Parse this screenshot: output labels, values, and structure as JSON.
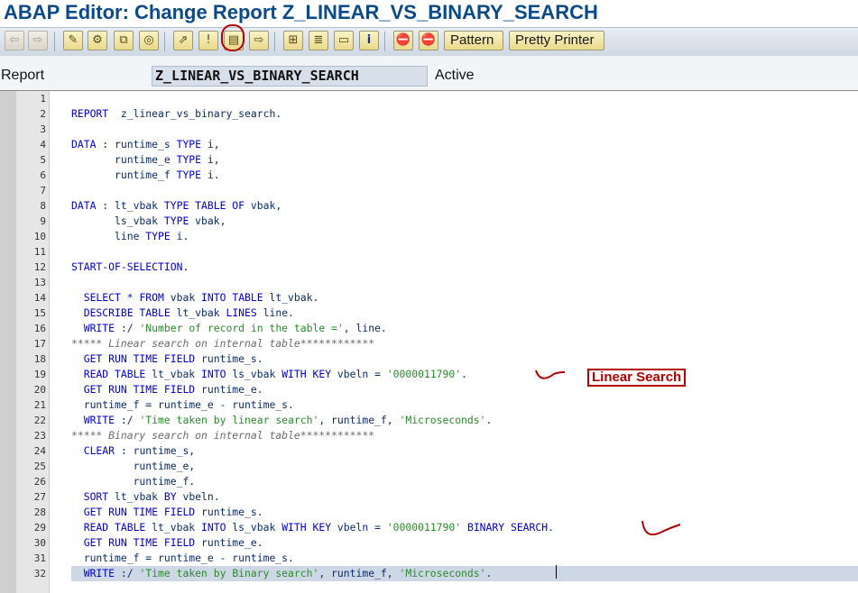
{
  "window": {
    "title": "ABAP Editor: Change Report Z_LINEAR_VS_BINARY_SEARCH"
  },
  "toolbar": {
    "buttons": [
      {
        "icon": "back-arrow-icon",
        "glyph": "⇦"
      },
      {
        "icon": "forward-arrow-icon",
        "glyph": "⇨"
      },
      {
        "icon": "display-change-icon",
        "glyph": "✎"
      },
      {
        "icon": "active-inactive-icon",
        "glyph": "⚙"
      },
      {
        "icon": "other-object-icon",
        "glyph": "⧉"
      },
      {
        "icon": "check-icon",
        "glyph": "◎"
      },
      {
        "icon": "activate-icon",
        "glyph": "⇗"
      },
      {
        "icon": "test-icon",
        "glyph": "!"
      },
      {
        "icon": "where-used-icon",
        "glyph": "▤"
      },
      {
        "icon": "navigate-icon",
        "glyph": "⇨"
      },
      {
        "icon": "object-list-icon",
        "glyph": "⊞"
      },
      {
        "icon": "display-object-list-icon",
        "glyph": "≣"
      },
      {
        "icon": "fullscreen-icon",
        "glyph": "▭"
      },
      {
        "icon": "info-icon",
        "glyph": "i"
      },
      {
        "icon": "breakpoint-icon",
        "glyph": "⛔"
      },
      {
        "icon": "session-breakpoint-icon",
        "glyph": "⛔"
      }
    ],
    "pattern_label": "Pattern",
    "pretty_printer_label": "Pretty Printer"
  },
  "report_bar": {
    "label": "Report",
    "name": "Z_LINEAR_VS_BINARY_SEARCH",
    "status": "Active"
  },
  "code_lines": [
    {
      "n": "1",
      "tokens": []
    },
    {
      "n": "2",
      "tokens": [
        {
          "t": "kw",
          "v": "REPORT"
        },
        {
          "t": "id",
          "v": "  z_linear_vs_binary_search."
        }
      ]
    },
    {
      "n": "3",
      "tokens": []
    },
    {
      "n": "4",
      "tokens": [
        {
          "t": "kw",
          "v": "DATA"
        },
        {
          "t": "id",
          "v": " : runtime_s "
        },
        {
          "t": "kw",
          "v": "TYPE"
        },
        {
          "t": "id",
          "v": " i,"
        }
      ]
    },
    {
      "n": "5",
      "tokens": [
        {
          "t": "id",
          "v": "       runtime_e "
        },
        {
          "t": "kw",
          "v": "TYPE"
        },
        {
          "t": "id",
          "v": " i,"
        }
      ]
    },
    {
      "n": "6",
      "tokens": [
        {
          "t": "id",
          "v": "       runtime_f "
        },
        {
          "t": "kw",
          "v": "TYPE"
        },
        {
          "t": "id",
          "v": " i."
        }
      ]
    },
    {
      "n": "7",
      "tokens": []
    },
    {
      "n": "8",
      "tokens": [
        {
          "t": "kw",
          "v": "DATA"
        },
        {
          "t": "id",
          "v": " : lt_vbak "
        },
        {
          "t": "kw",
          "v": "TYPE TABLE OF"
        },
        {
          "t": "id",
          "v": " vbak,"
        }
      ]
    },
    {
      "n": "9",
      "tokens": [
        {
          "t": "id",
          "v": "       ls_vbak "
        },
        {
          "t": "kw",
          "v": "TYPE"
        },
        {
          "t": "id",
          "v": " vbak,"
        }
      ]
    },
    {
      "n": "10",
      "tokens": [
        {
          "t": "id",
          "v": "       line "
        },
        {
          "t": "kw",
          "v": "TYPE"
        },
        {
          "t": "id",
          "v": " i."
        }
      ]
    },
    {
      "n": "11",
      "tokens": []
    },
    {
      "n": "12",
      "tokens": [
        {
          "t": "kw",
          "v": "START-OF-SELECTION."
        }
      ]
    },
    {
      "n": "13",
      "tokens": []
    },
    {
      "n": "14",
      "tokens": [
        {
          "t": "kw",
          "v": "  SELECT"
        },
        {
          "t": "id",
          "v": " * "
        },
        {
          "t": "kw",
          "v": "FROM"
        },
        {
          "t": "id",
          "v": " vbak "
        },
        {
          "t": "kw",
          "v": "INTO TABLE"
        },
        {
          "t": "id",
          "v": " lt_vbak."
        }
      ]
    },
    {
      "n": "15",
      "tokens": [
        {
          "t": "kw",
          "v": "  DESCRIBE TABLE"
        },
        {
          "t": "id",
          "v": " lt_vbak "
        },
        {
          "t": "kw",
          "v": "LINES"
        },
        {
          "t": "id",
          "v": " line."
        }
      ]
    },
    {
      "n": "16",
      "tokens": [
        {
          "t": "kw",
          "v": "  WRITE"
        },
        {
          "t": "id",
          "v": " :/ "
        },
        {
          "t": "st",
          "v": "'Number of record in the table ='"
        },
        {
          "t": "id",
          "v": ", line."
        }
      ]
    },
    {
      "n": "17",
      "tokens": [
        {
          "t": "cm",
          "v": "***** Linear search on internal table************"
        }
      ]
    },
    {
      "n": "18",
      "tokens": [
        {
          "t": "kw",
          "v": "  GET RUN TIME FIELD"
        },
        {
          "t": "id",
          "v": " runtime_s."
        }
      ]
    },
    {
      "n": "19",
      "tokens": [
        {
          "t": "kw",
          "v": "  READ TABLE"
        },
        {
          "t": "id",
          "v": " lt_vbak "
        },
        {
          "t": "kw",
          "v": "INTO"
        },
        {
          "t": "id",
          "v": " ls_vbak "
        },
        {
          "t": "kw",
          "v": "WITH KEY"
        },
        {
          "t": "id",
          "v": " vbeln = "
        },
        {
          "t": "st",
          "v": "'0000011790'"
        },
        {
          "t": "id",
          "v": "."
        }
      ]
    },
    {
      "n": "20",
      "tokens": [
        {
          "t": "kw",
          "v": "  GET RUN TIME FIELD"
        },
        {
          "t": "id",
          "v": " runtime_e."
        }
      ]
    },
    {
      "n": "21",
      "tokens": [
        {
          "t": "id",
          "v": "  runtime_f = runtime_e - runtime_s."
        }
      ]
    },
    {
      "n": "22",
      "tokens": [
        {
          "t": "kw",
          "v": "  WRITE"
        },
        {
          "t": "id",
          "v": " :/ "
        },
        {
          "t": "st",
          "v": "'Time taken by linear search'"
        },
        {
          "t": "id",
          "v": ", runtime_f, "
        },
        {
          "t": "st",
          "v": "'Microseconds'"
        },
        {
          "t": "id",
          "v": "."
        }
      ]
    },
    {
      "n": "23",
      "tokens": [
        {
          "t": "cm",
          "v": "***** Binary search on internal table************"
        }
      ]
    },
    {
      "n": "24",
      "tokens": [
        {
          "t": "kw",
          "v": "  CLEAR"
        },
        {
          "t": "id",
          "v": " : runtime_s,"
        }
      ]
    },
    {
      "n": "25",
      "tokens": [
        {
          "t": "id",
          "v": "          runtime_e,"
        }
      ]
    },
    {
      "n": "26",
      "tokens": [
        {
          "t": "id",
          "v": "          runtime_f."
        }
      ]
    },
    {
      "n": "27",
      "tokens": [
        {
          "t": "kw",
          "v": "  SORT"
        },
        {
          "t": "id",
          "v": " lt_vbak "
        },
        {
          "t": "kw",
          "v": "BY"
        },
        {
          "t": "id",
          "v": " vbeln."
        }
      ]
    },
    {
      "n": "28",
      "tokens": [
        {
          "t": "kw",
          "v": "  GET RUN TIME FIELD"
        },
        {
          "t": "id",
          "v": " runtime_s."
        }
      ]
    },
    {
      "n": "29",
      "tokens": [
        {
          "t": "kw",
          "v": "  READ TABLE"
        },
        {
          "t": "id",
          "v": " lt_vbak "
        },
        {
          "t": "kw",
          "v": "INTO"
        },
        {
          "t": "id",
          "v": " ls_vbak "
        },
        {
          "t": "kw",
          "v": "WITH KEY"
        },
        {
          "t": "id",
          "v": " vbeln = "
        },
        {
          "t": "st",
          "v": "'0000011790'"
        },
        {
          "t": "kw",
          "v": " BINARY SEARCH"
        },
        {
          "t": "id",
          "v": "."
        }
      ]
    },
    {
      "n": "30",
      "tokens": [
        {
          "t": "kw",
          "v": "  GET RUN TIME FIELD"
        },
        {
          "t": "id",
          "v": " runtime_e."
        }
      ]
    },
    {
      "n": "31",
      "tokens": [
        {
          "t": "id",
          "v": "  runtime_f = runtime_e - runtime_s."
        }
      ]
    },
    {
      "n": "32",
      "tokens": [
        {
          "t": "kw",
          "v": "  WRITE"
        },
        {
          "t": "id",
          "v": " :/ "
        },
        {
          "t": "st",
          "v": "'Time taken by Binary search'"
        },
        {
          "t": "id",
          "v": ", runtime_f, "
        },
        {
          "t": "st",
          "v": "'Microseconds'"
        },
        {
          "t": "id",
          "v": "."
        }
      ],
      "highlight": true
    }
  ],
  "annotations": {
    "linear_search_label": "Linear Search"
  },
  "colors": {
    "title": "#0b4a88",
    "keyword": "#0000cc",
    "string": "#2a8a2a",
    "comment": "#6b6b6b",
    "annotation": "#b30000"
  }
}
